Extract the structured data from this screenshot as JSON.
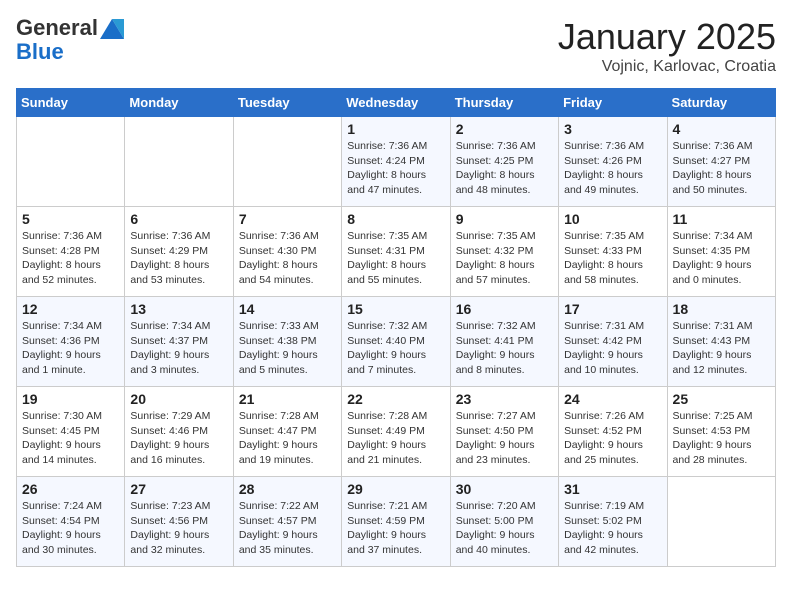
{
  "header": {
    "logo_general": "General",
    "logo_blue": "Blue",
    "month_title": "January 2025",
    "location": "Vojnic, Karlovac, Croatia"
  },
  "days_of_week": [
    "Sunday",
    "Monday",
    "Tuesday",
    "Wednesday",
    "Thursday",
    "Friday",
    "Saturday"
  ],
  "weeks": [
    [
      {
        "day": "",
        "info": ""
      },
      {
        "day": "",
        "info": ""
      },
      {
        "day": "",
        "info": ""
      },
      {
        "day": "1",
        "info": "Sunrise: 7:36 AM\nSunset: 4:24 PM\nDaylight: 8 hours and 47 minutes."
      },
      {
        "day": "2",
        "info": "Sunrise: 7:36 AM\nSunset: 4:25 PM\nDaylight: 8 hours and 48 minutes."
      },
      {
        "day": "3",
        "info": "Sunrise: 7:36 AM\nSunset: 4:26 PM\nDaylight: 8 hours and 49 minutes."
      },
      {
        "day": "4",
        "info": "Sunrise: 7:36 AM\nSunset: 4:27 PM\nDaylight: 8 hours and 50 minutes."
      }
    ],
    [
      {
        "day": "5",
        "info": "Sunrise: 7:36 AM\nSunset: 4:28 PM\nDaylight: 8 hours and 52 minutes."
      },
      {
        "day": "6",
        "info": "Sunrise: 7:36 AM\nSunset: 4:29 PM\nDaylight: 8 hours and 53 minutes."
      },
      {
        "day": "7",
        "info": "Sunrise: 7:36 AM\nSunset: 4:30 PM\nDaylight: 8 hours and 54 minutes."
      },
      {
        "day": "8",
        "info": "Sunrise: 7:35 AM\nSunset: 4:31 PM\nDaylight: 8 hours and 55 minutes."
      },
      {
        "day": "9",
        "info": "Sunrise: 7:35 AM\nSunset: 4:32 PM\nDaylight: 8 hours and 57 minutes."
      },
      {
        "day": "10",
        "info": "Sunrise: 7:35 AM\nSunset: 4:33 PM\nDaylight: 8 hours and 58 minutes."
      },
      {
        "day": "11",
        "info": "Sunrise: 7:34 AM\nSunset: 4:35 PM\nDaylight: 9 hours and 0 minutes."
      }
    ],
    [
      {
        "day": "12",
        "info": "Sunrise: 7:34 AM\nSunset: 4:36 PM\nDaylight: 9 hours and 1 minute."
      },
      {
        "day": "13",
        "info": "Sunrise: 7:34 AM\nSunset: 4:37 PM\nDaylight: 9 hours and 3 minutes."
      },
      {
        "day": "14",
        "info": "Sunrise: 7:33 AM\nSunset: 4:38 PM\nDaylight: 9 hours and 5 minutes."
      },
      {
        "day": "15",
        "info": "Sunrise: 7:32 AM\nSunset: 4:40 PM\nDaylight: 9 hours and 7 minutes."
      },
      {
        "day": "16",
        "info": "Sunrise: 7:32 AM\nSunset: 4:41 PM\nDaylight: 9 hours and 8 minutes."
      },
      {
        "day": "17",
        "info": "Sunrise: 7:31 AM\nSunset: 4:42 PM\nDaylight: 9 hours and 10 minutes."
      },
      {
        "day": "18",
        "info": "Sunrise: 7:31 AM\nSunset: 4:43 PM\nDaylight: 9 hours and 12 minutes."
      }
    ],
    [
      {
        "day": "19",
        "info": "Sunrise: 7:30 AM\nSunset: 4:45 PM\nDaylight: 9 hours and 14 minutes."
      },
      {
        "day": "20",
        "info": "Sunrise: 7:29 AM\nSunset: 4:46 PM\nDaylight: 9 hours and 16 minutes."
      },
      {
        "day": "21",
        "info": "Sunrise: 7:28 AM\nSunset: 4:47 PM\nDaylight: 9 hours and 19 minutes."
      },
      {
        "day": "22",
        "info": "Sunrise: 7:28 AM\nSunset: 4:49 PM\nDaylight: 9 hours and 21 minutes."
      },
      {
        "day": "23",
        "info": "Sunrise: 7:27 AM\nSunset: 4:50 PM\nDaylight: 9 hours and 23 minutes."
      },
      {
        "day": "24",
        "info": "Sunrise: 7:26 AM\nSunset: 4:52 PM\nDaylight: 9 hours and 25 minutes."
      },
      {
        "day": "25",
        "info": "Sunrise: 7:25 AM\nSunset: 4:53 PM\nDaylight: 9 hours and 28 minutes."
      }
    ],
    [
      {
        "day": "26",
        "info": "Sunrise: 7:24 AM\nSunset: 4:54 PM\nDaylight: 9 hours and 30 minutes."
      },
      {
        "day": "27",
        "info": "Sunrise: 7:23 AM\nSunset: 4:56 PM\nDaylight: 9 hours and 32 minutes."
      },
      {
        "day": "28",
        "info": "Sunrise: 7:22 AM\nSunset: 4:57 PM\nDaylight: 9 hours and 35 minutes."
      },
      {
        "day": "29",
        "info": "Sunrise: 7:21 AM\nSunset: 4:59 PM\nDaylight: 9 hours and 37 minutes."
      },
      {
        "day": "30",
        "info": "Sunrise: 7:20 AM\nSunset: 5:00 PM\nDaylight: 9 hours and 40 minutes."
      },
      {
        "day": "31",
        "info": "Sunrise: 7:19 AM\nSunset: 5:02 PM\nDaylight: 9 hours and 42 minutes."
      },
      {
        "day": "",
        "info": ""
      }
    ]
  ]
}
